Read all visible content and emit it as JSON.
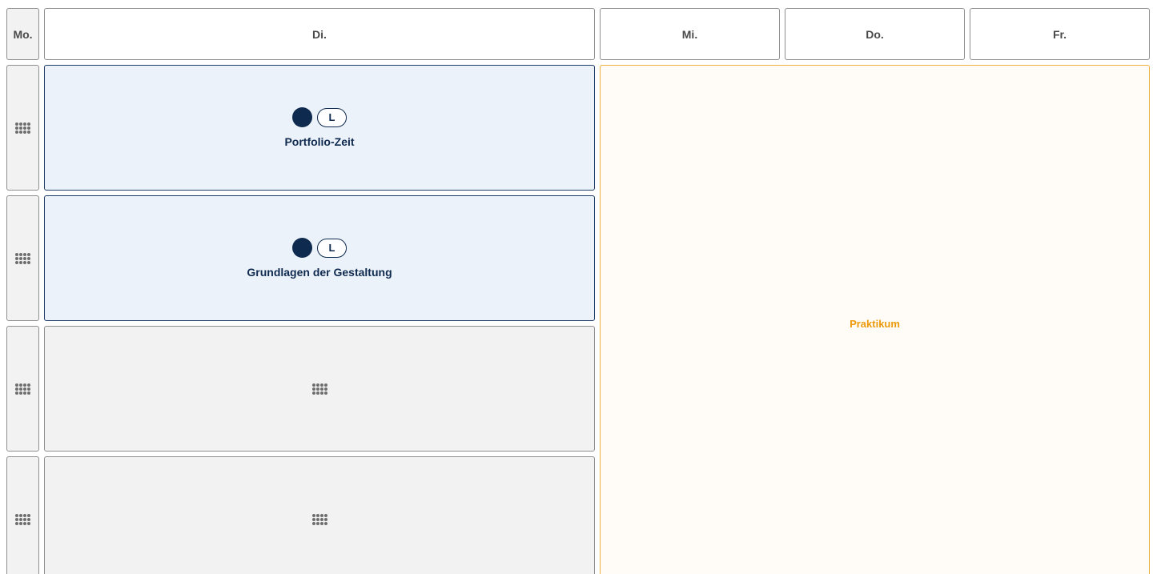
{
  "days": {
    "mon": "Mo.",
    "tue": "Di.",
    "wed": "Mi.",
    "thu": "Do.",
    "fri": "Fr."
  },
  "lessons": [
    {
      "badge": "L",
      "title": "Portfolio-Zeit"
    },
    {
      "badge": "L",
      "title": "Grundlagen der Gestaltung"
    }
  ],
  "block": {
    "label": "Praktikum"
  },
  "icons": {
    "slot": "grid-icon",
    "lesson_marker": "filled-circle"
  },
  "colors": {
    "lesson_bg": "#ecf2fa",
    "lesson_accent": "#0f2a4f",
    "empty_bg": "#f2f2f2",
    "praktikum_text": "#eb9a0a",
    "praktikum_border": "#f0b040",
    "praktikum_bg": "#fffbf6"
  }
}
